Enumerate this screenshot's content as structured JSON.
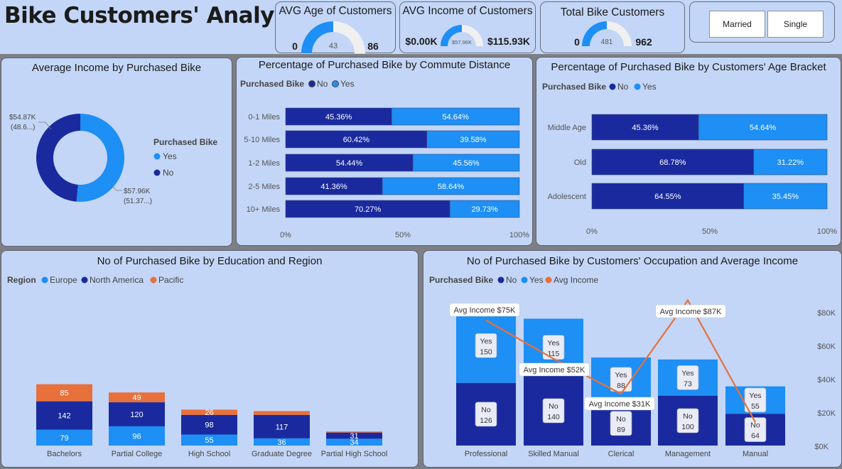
{
  "title": "Bike Customers' Analysis",
  "colors": {
    "no": "#1a2a9e",
    "yes": "#1d8ff5",
    "europe": "#1d8ff5",
    "north_america": "#1a2a9e",
    "pacific": "#e8703a",
    "avg_income": "#e8703a",
    "panel_bg": "#c3d6f7",
    "gauge_track": "#f0f0f0"
  },
  "kpis": {
    "age": {
      "title": "AVG Age of Customers",
      "min": "0",
      "value": "43",
      "max": "86",
      "fraction": 0.5
    },
    "income": {
      "title": "AVG Income of Customers",
      "min": "$0.00K",
      "value": "$57.96K",
      "max": "$115.93K",
      "fraction": 0.5
    },
    "total": {
      "title": "Total Bike Customers",
      "min": "0",
      "value": "481",
      "max": "962",
      "fraction": 0.5
    }
  },
  "slicer": {
    "options": [
      "Married",
      "Single"
    ]
  },
  "donut": {
    "title": "Average Income by Purchased Bike",
    "legend_title": "Purchased Bike",
    "legend": [
      "Yes",
      "No"
    ],
    "label_no": [
      "$54.87K",
      "(48.6...)"
    ],
    "label_yes": [
      "$57.96K",
      "(51.37...)"
    ]
  },
  "commute": {
    "title": "Percentage of Purchased Bike by Commute Distance",
    "legend_title": "Purchased Bike",
    "legend": [
      "No",
      "Yes"
    ],
    "axis_ticks": [
      "0%",
      "50%",
      "100%"
    ]
  },
  "age_bracket": {
    "title": "Percentage of Purchased Bike by Customers' Age Bracket",
    "legend_title": "Purchased Bike",
    "legend": [
      "No",
      "Yes"
    ],
    "axis_ticks": [
      "0%",
      "50%",
      "100%"
    ]
  },
  "education": {
    "title": "No of Purchased Bike by Education and Region",
    "legend_title": "Region",
    "legend": [
      "Europe",
      "North America",
      "Pacific"
    ]
  },
  "occupation": {
    "title": "No of Purchased Bike by Customers' Occupation and Average Income",
    "legend_title": "Purchased Bike",
    "legend": [
      "No",
      "Yes",
      "Avg Income"
    ],
    "axis_ticks": [
      "$0K",
      "$20K",
      "$40K",
      "$60K",
      "$80K"
    ]
  },
  "chart_data": [
    {
      "type": "pie",
      "title": "Average Income by Purchased Bike",
      "categories": [
        "Yes",
        "No"
      ],
      "values": [
        57.96,
        54.87
      ],
      "unit": "$K",
      "percent_labels": [
        "(51.37...)",
        "(48.6...)"
      ]
    },
    {
      "type": "bar",
      "title": "Percentage of Purchased Bike by Commute Distance",
      "orientation": "horizontal",
      "stacked": "100%",
      "categories": [
        "0-1 Miles",
        "5-10 Miles",
        "1-2 Miles",
        "2-5 Miles",
        "10+ Miles"
      ],
      "series": [
        {
          "name": "No",
          "values": [
            45.36,
            60.42,
            54.44,
            41.36,
            70.27
          ]
        },
        {
          "name": "Yes",
          "values": [
            54.64,
            39.58,
            45.56,
            58.64,
            29.73
          ]
        }
      ],
      "xlim": [
        0,
        100
      ]
    },
    {
      "type": "bar",
      "title": "Percentage of Purchased Bike by Customers' Age Bracket",
      "orientation": "horizontal",
      "stacked": "100%",
      "categories": [
        "Middle Age",
        "Old",
        "Adolescent"
      ],
      "series": [
        {
          "name": "No",
          "values": [
            45.36,
            68.78,
            64.55
          ]
        },
        {
          "name": "Yes",
          "values": [
            54.64,
            31.22,
            35.45
          ]
        }
      ],
      "xlim": [
        0,
        100
      ]
    },
    {
      "type": "bar",
      "title": "No of Purchased Bike by Education and Region",
      "stacked": true,
      "categories": [
        "Bachelors",
        "Partial College",
        "High School",
        "Graduate Degree",
        "Partial High School"
      ],
      "series": [
        {
          "name": "Europe",
          "values": [
            79,
            96,
            55,
            36,
            34
          ]
        },
        {
          "name": "North America",
          "values": [
            142,
            120,
            98,
            117,
            31
          ]
        },
        {
          "name": "Pacific",
          "values": [
            85,
            49,
            26,
            19,
            5
          ]
        }
      ],
      "labels_shown": {
        "Pacific": [
          true,
          true,
          true,
          false,
          false
        ]
      }
    },
    {
      "type": "bar",
      "title": "No of Purchased Bike by Customers' Occupation and Average Income",
      "stacked": true,
      "categories": [
        "Professional",
        "Skilled Manual",
        "Clerical",
        "Management",
        "Manual"
      ],
      "series": [
        {
          "name": "No",
          "values": [
            126,
            140,
            89,
            100,
            64
          ]
        },
        {
          "name": "Yes",
          "values": [
            150,
            115,
            88,
            73,
            55
          ]
        }
      ],
      "line_series": {
        "name": "Avg Income",
        "values": [
          75,
          52,
          31,
          87,
          14
        ],
        "unit": "$K",
        "labels": [
          "Avg Income $75K",
          "Avg Income $52K",
          "Avg Income $31K",
          "Avg Income $87K",
          ""
        ]
      },
      "y2lim": [
        0,
        80
      ]
    }
  ]
}
